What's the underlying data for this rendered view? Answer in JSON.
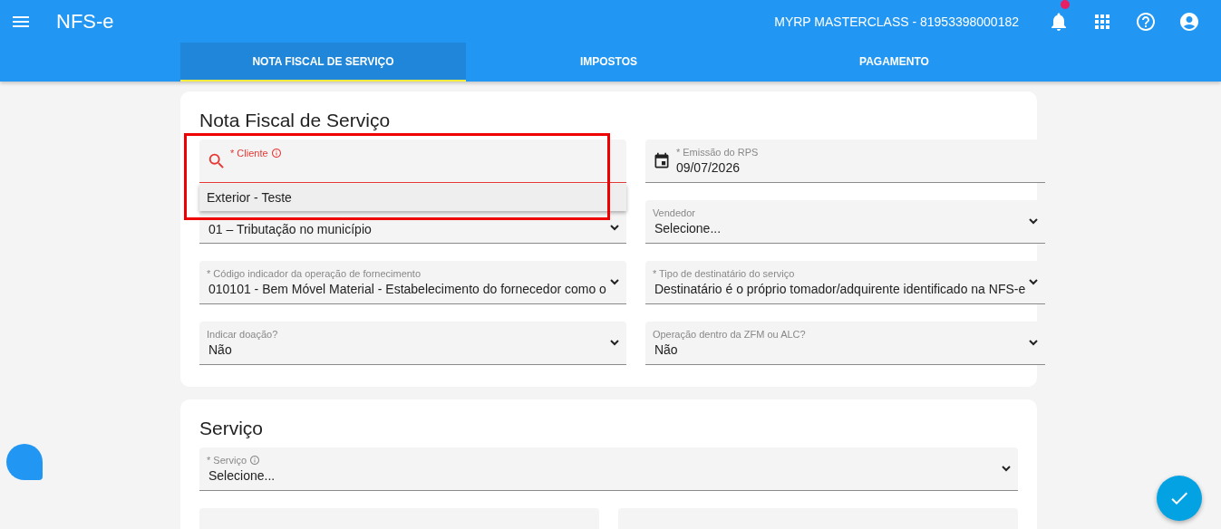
{
  "app_bar": {
    "title": "NFS-e",
    "company": "MYRP MASTERCLASS - 81953398000182",
    "notification_badge": true
  },
  "tabs": [
    {
      "label": "NOTA FISCAL DE SERVIÇO",
      "selected": true
    },
    {
      "label": "IMPOSTOS",
      "selected": false
    },
    {
      "label": "PAGAMENTO",
      "selected": false
    }
  ],
  "sections": [
    {
      "title": "Nota Fiscal de Serviço",
      "fields": [
        {
          "kind": "autocomplete",
          "label": "* Cliente",
          "info": true,
          "focused": true,
          "suggestions": [
            "Exterior - Teste"
          ],
          "highlighted": true
        },
        {
          "kind": "date",
          "label": "* Emissão do RPS",
          "value": "09/07/2026"
        },
        {
          "kind": "select",
          "value": "01 – Tributação no município"
        },
        {
          "kind": "select",
          "label": "Vendedor",
          "value": "Selecione..."
        },
        {
          "kind": "select",
          "label": "* Código indicador da operação de fornecimento",
          "value": "010101 - Bem Móvel Material - Estabelecimento do fornecedor como o"
        },
        {
          "kind": "select",
          "label": "* Tipo de destinatário do serviço",
          "value": "Destinatário é o próprio tomador/adquirente identificado na NFS-e"
        },
        {
          "kind": "select",
          "label": "Indicar doação?",
          "value": "Não"
        },
        {
          "kind": "select",
          "label": "Operação dentro da ZFM ou ALC?",
          "value": "Não"
        }
      ]
    },
    {
      "title": "Serviço",
      "fields": [
        {
          "kind": "select",
          "label": "* Serviço",
          "info": true,
          "value": "Selecione...",
          "wide": true
        },
        {
          "kind": "blank"
        },
        {
          "kind": "blank"
        }
      ]
    }
  ]
}
